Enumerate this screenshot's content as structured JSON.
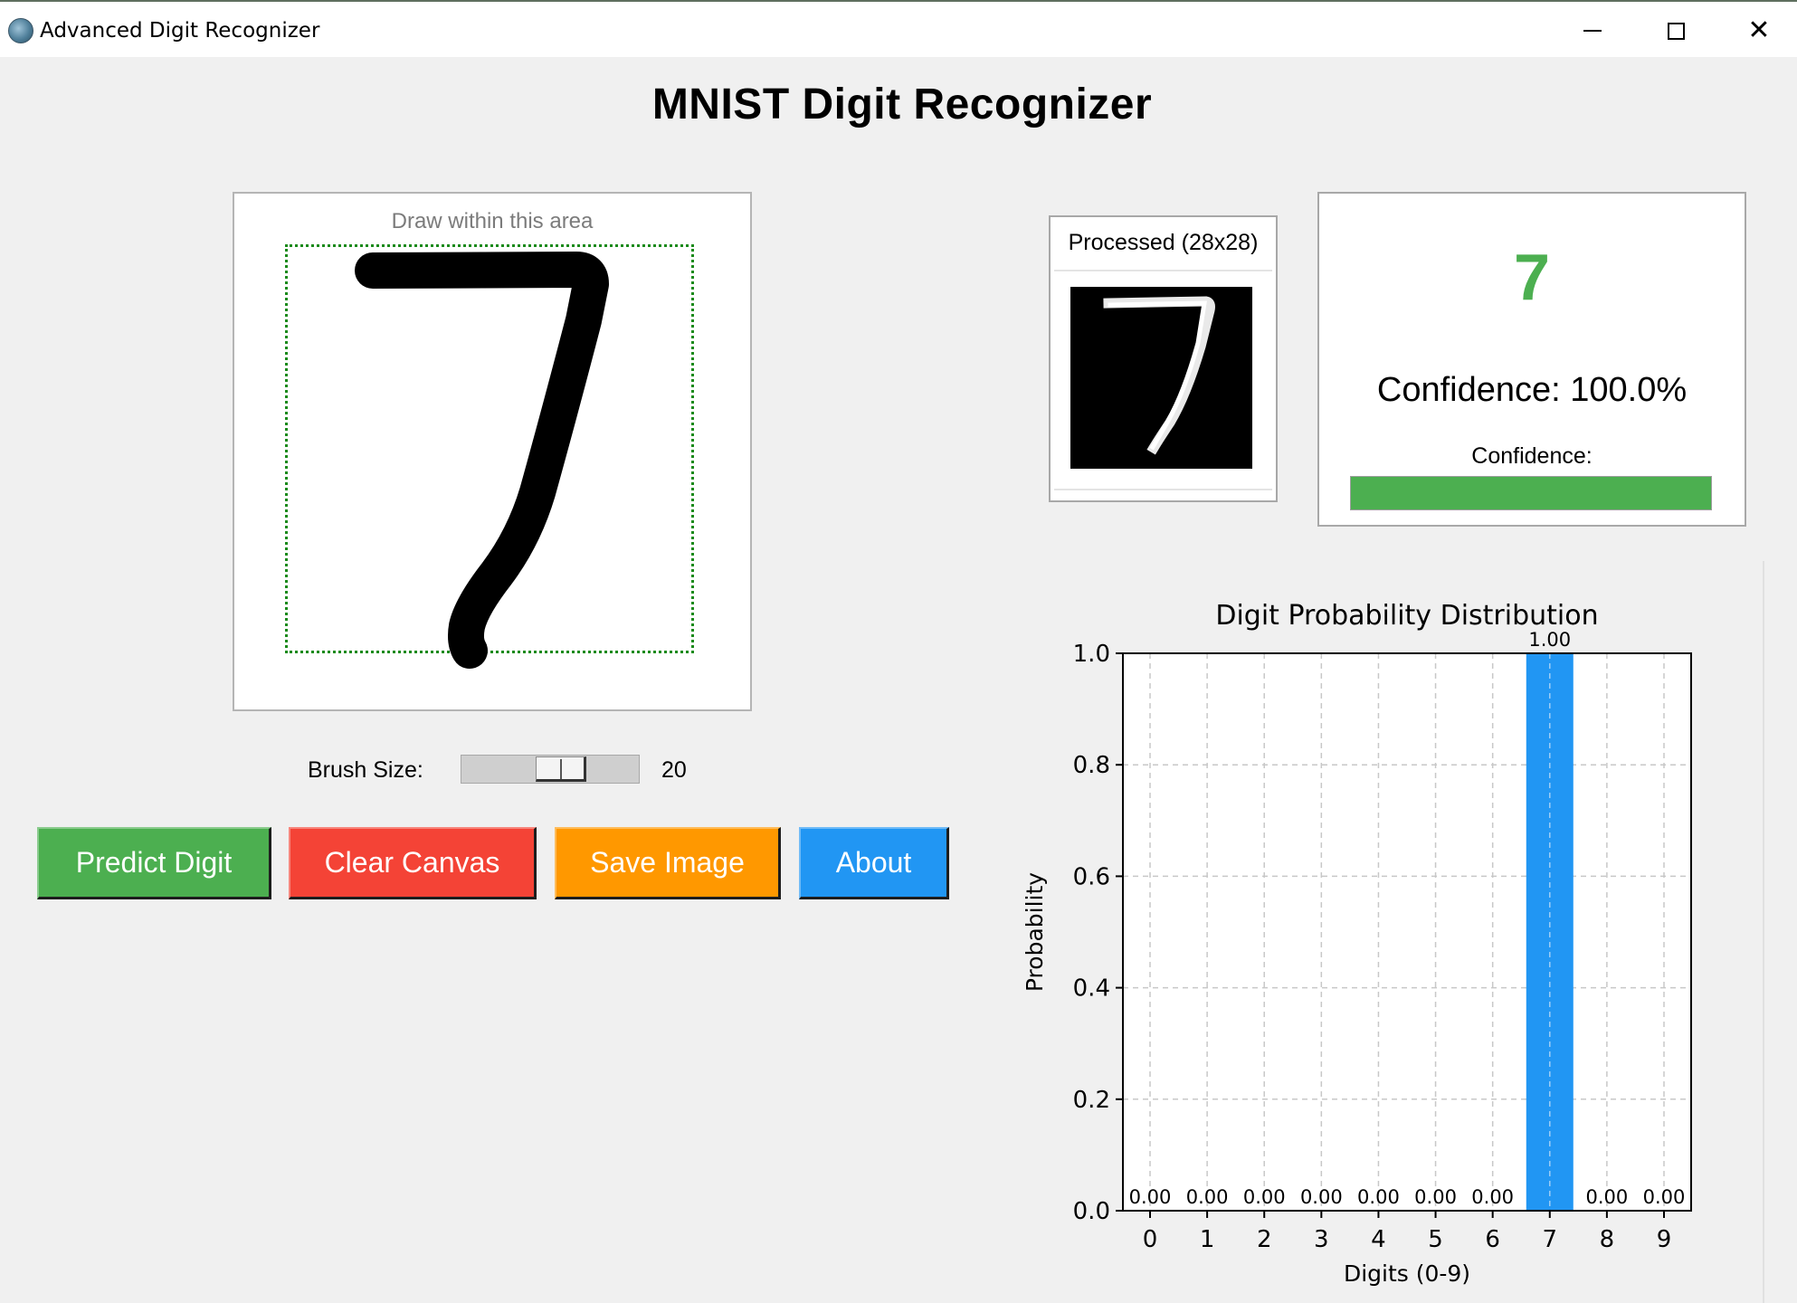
{
  "window": {
    "title": "Advanced Digit Recognizer",
    "controls": [
      "minimize",
      "maximize",
      "close"
    ]
  },
  "heading": "MNIST Digit Recognizer",
  "drawing": {
    "hint": "Draw within this area",
    "area_border_color": "#1a8a1a"
  },
  "brush": {
    "label": "Brush Size:",
    "value": "20",
    "slider_fraction": 0.4
  },
  "buttons": {
    "predict": "Predict Digit",
    "clear": "Clear Canvas",
    "save": "Save Image",
    "about": "About"
  },
  "colors": {
    "predict": "#4caf50",
    "clear": "#f44336",
    "save": "#ff9800",
    "about": "#2196f3",
    "bar": "#2196f3",
    "result": "#4caf50"
  },
  "processed": {
    "title": "Processed (28x28)"
  },
  "result": {
    "digit": "7",
    "confidence_text": "Confidence: 100.0%",
    "confidence_label": "Confidence:",
    "confidence_fraction": 1.0
  },
  "chart_data": {
    "type": "bar",
    "title": "Digit Probability Distribution",
    "xlabel": "Digits (0-9)",
    "ylabel": "Probability",
    "categories": [
      "0",
      "1",
      "2",
      "3",
      "4",
      "5",
      "6",
      "7",
      "8",
      "9"
    ],
    "values": [
      0.0,
      0.0,
      0.0,
      0.0,
      0.0,
      0.0,
      0.0,
      1.0,
      0.0,
      0.0
    ],
    "data_labels": [
      "0.00",
      "0.00",
      "0.00",
      "0.00",
      "0.00",
      "0.00",
      "0.00",
      "1.00",
      "0.00",
      "0.00"
    ],
    "ylim": [
      0,
      1.0
    ],
    "yticks": [
      "0.0",
      "0.2",
      "0.4",
      "0.6",
      "0.8",
      "1.0"
    ],
    "grid": true,
    "bar_color": "#2196f3"
  }
}
